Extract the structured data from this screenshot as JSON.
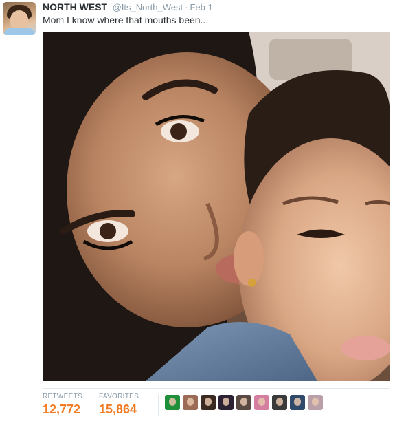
{
  "tweet": {
    "display_name": "NORTH WEST",
    "handle": "@Its_North_West",
    "separator": "·",
    "timestamp": "Feb 1",
    "text": "Mom I know where that mouths been..."
  },
  "stats": {
    "retweets_label": "RETWEETS",
    "retweets_count": "12,772",
    "favorites_label": "FAVORITES",
    "favorites_count": "15,864",
    "accent_color": "#f27c24"
  },
  "favoriter_avatars": [
    {
      "name": "favoriter-avatar-1",
      "color": "#1f8f3a"
    },
    {
      "name": "favoriter-avatar-2",
      "color": "#9b6b55"
    },
    {
      "name": "favoriter-avatar-3",
      "color": "#3b2a22"
    },
    {
      "name": "favoriter-avatar-4",
      "color": "#2d2233"
    },
    {
      "name": "favoriter-avatar-5",
      "color": "#5a4a44"
    },
    {
      "name": "favoriter-avatar-6",
      "color": "#d47fa0"
    },
    {
      "name": "favoriter-avatar-7",
      "color": "#3a3a3a"
    },
    {
      "name": "favoriter-avatar-8",
      "color": "#2f4a6a"
    },
    {
      "name": "favoriter-avatar-9",
      "color": "#b9a0a8"
    }
  ]
}
